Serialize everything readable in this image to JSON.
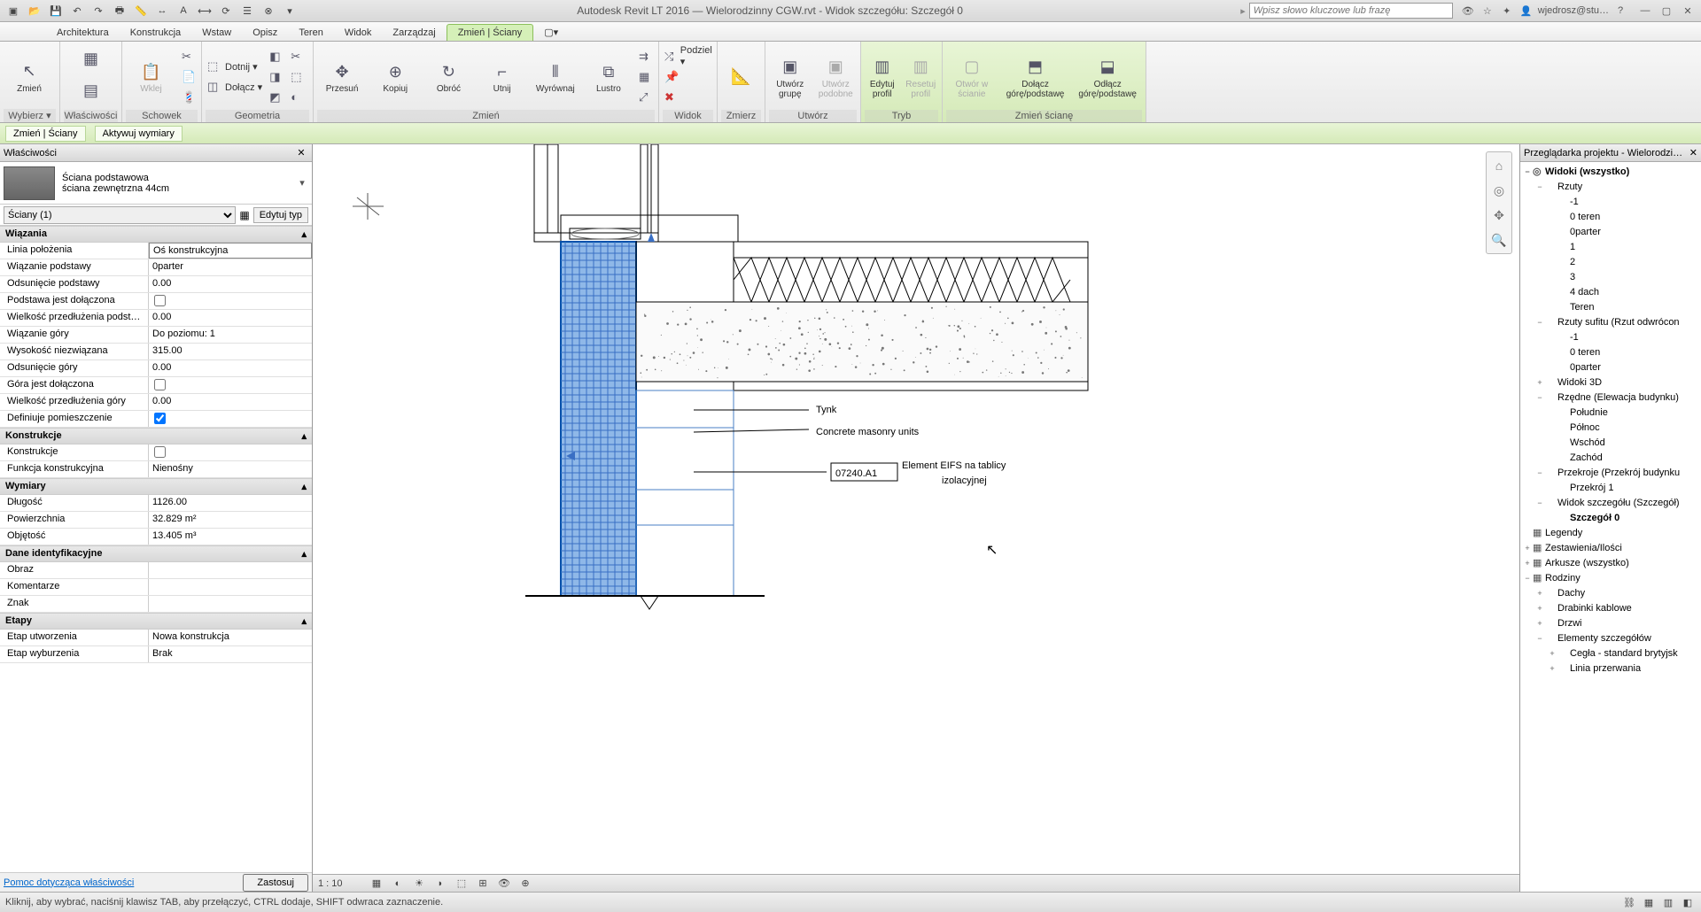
{
  "title": "Autodesk Revit LT 2016 — Wielorodzinny CGW.rvt - Widok szczegółu: Szczegół 0",
  "search_ph": "Wpisz słowo kluczowe lub frazę",
  "user": "wjedrosz@stu…",
  "tabs": [
    "Architektura",
    "Konstrukcja",
    "Wstaw",
    "Opisz",
    "Teren",
    "Widok",
    "Zarządzaj",
    "Zmień | Ściany"
  ],
  "active_tab": 7,
  "ribbon": {
    "wybierz": {
      "lbl": "Wybierz ▾",
      "btn": "Zmień"
    },
    "wlasc": {
      "lbl": "Właściwości"
    },
    "schowek": {
      "lbl": "Schowek",
      "wklej": "Wklej"
    },
    "geo": {
      "lbl": "Geometria",
      "dotnij": "Dotnij ▾",
      "dolacz": "Dołącz ▾"
    },
    "zm": {
      "lbl": "Zmień",
      "przesun": "Przesuń",
      "kopiuj": "Kopiuj",
      "obroc": "Obróć",
      "utnij": "Utnij",
      "wyrownaj": "Wyrównaj",
      "lustro": "Lustro"
    },
    "widok": {
      "lbl": "Widok",
      "podziel": "Podziel ▾"
    },
    "zmierz": {
      "lbl": "Zmierz"
    },
    "utworz": {
      "lbl": "Utwórz",
      "grupe": "Utwórz\ngrupę",
      "podobne": "Utwórz\npodobne"
    },
    "tryb": {
      "lbl": "Tryb",
      "edytuj": "Edytuj\nprofil",
      "resetuj": "Resetuj\nprofil"
    },
    "sciane": {
      "lbl": "Zmień ścianę",
      "otwor": "Otwór\nw ścianie",
      "dolg": "Dołącz\ngórę/podstawę",
      "odlg": "Odłącz\ngórę/podstawę"
    }
  },
  "subrib": [
    "Zmień | Ściany",
    "Aktywuj wymiary"
  ],
  "props": {
    "hdr": "Właściwości",
    "type_name": "Ściana podstawowa",
    "type_sub": "ściana zewnętrzna 44cm",
    "filter": "Ściany (1)",
    "edit_type": "Edytuj typ",
    "groups": [
      {
        "name": "Wiązania",
        "rows": [
          {
            "n": "Linia położenia",
            "v": "Oś konstrukcyjna",
            "sel": true
          },
          {
            "n": "Wiązanie podstawy",
            "v": "0parter"
          },
          {
            "n": "Odsunięcie podstawy",
            "v": "0.00"
          },
          {
            "n": "Podstawa jest dołączona",
            "v": "",
            "chk": false
          },
          {
            "n": "Wielkość przedłużenia podst…",
            "v": "0.00"
          },
          {
            "n": "Wiązanie góry",
            "v": "Do poziomu: 1"
          },
          {
            "n": "Wysokość niezwiązana",
            "v": "315.00"
          },
          {
            "n": "Odsunięcie góry",
            "v": "0.00"
          },
          {
            "n": "Góra jest dołączona",
            "v": "",
            "chk": false
          },
          {
            "n": "Wielkość przedłużenia góry",
            "v": "0.00"
          },
          {
            "n": "Definiuje pomieszczenie",
            "v": "",
            "chk": true
          }
        ]
      },
      {
        "name": "Konstrukcje",
        "rows": [
          {
            "n": "Konstrukcje",
            "v": "",
            "chk": false
          },
          {
            "n": "Funkcja konstrukcyjna",
            "v": "Nienośny"
          }
        ]
      },
      {
        "name": "Wymiary",
        "rows": [
          {
            "n": "Długość",
            "v": "1126.00"
          },
          {
            "n": "Powierzchnia",
            "v": "32.829 m²"
          },
          {
            "n": "Objętość",
            "v": "13.405 m³"
          }
        ]
      },
      {
        "name": "Dane identyfikacyjne",
        "rows": [
          {
            "n": "Obraz",
            "v": ""
          },
          {
            "n": "Komentarze",
            "v": ""
          },
          {
            "n": "Znak",
            "v": ""
          }
        ]
      },
      {
        "name": "Etapy",
        "rows": [
          {
            "n": "Etap utworzenia",
            "v": "Nowa konstrukcja"
          },
          {
            "n": "Etap wyburzenia",
            "v": "Brak"
          }
        ]
      }
    ],
    "help": "Pomoc dotycząca właściwości",
    "apply": "Zastosuj"
  },
  "canvas": {
    "scale": "1 : 10",
    "labels": {
      "tynk": "Tynk",
      "cmu": "Concrete masonry units",
      "eifs_code": "07240.A1",
      "eifs": "Element EIFS na tablicy\nizolacyjnej"
    }
  },
  "browser": {
    "hdr": "Przeglądarka projektu - Wielorodzi…",
    "nodes": [
      {
        "l": 0,
        "tw": "−",
        "ic": "◎",
        "t": "Widoki (wszystko)",
        "b": true
      },
      {
        "l": 1,
        "tw": "−",
        "t": "Rzuty"
      },
      {
        "l": 2,
        "t": "-1"
      },
      {
        "l": 2,
        "t": "0 teren"
      },
      {
        "l": 2,
        "t": "0parter"
      },
      {
        "l": 2,
        "t": "1"
      },
      {
        "l": 2,
        "t": "2"
      },
      {
        "l": 2,
        "t": "3"
      },
      {
        "l": 2,
        "t": "4 dach"
      },
      {
        "l": 2,
        "t": "Teren"
      },
      {
        "l": 1,
        "tw": "−",
        "t": "Rzuty sufitu (Rzut odwrócon"
      },
      {
        "l": 2,
        "t": "-1"
      },
      {
        "l": 2,
        "t": "0 teren"
      },
      {
        "l": 2,
        "t": "0parter"
      },
      {
        "l": 1,
        "tw": "+",
        "t": "Widoki 3D"
      },
      {
        "l": 1,
        "tw": "−",
        "t": "Rzędne (Elewacja budynku)"
      },
      {
        "l": 2,
        "t": "Południe"
      },
      {
        "l": 2,
        "t": "Północ"
      },
      {
        "l": 2,
        "t": "Wschód"
      },
      {
        "l": 2,
        "t": "Zachód"
      },
      {
        "l": 1,
        "tw": "−",
        "t": "Przekroje (Przekrój budynku"
      },
      {
        "l": 2,
        "t": "Przekrój 1"
      },
      {
        "l": 1,
        "tw": "−",
        "t": "Widok szczegółu (Szczegół)"
      },
      {
        "l": 2,
        "t": "Szczegół 0",
        "b": true
      },
      {
        "l": 0,
        "tw": "",
        "ic": "▦",
        "t": "Legendy"
      },
      {
        "l": 0,
        "tw": "+",
        "ic": "▦",
        "t": "Zestawienia/Ilości"
      },
      {
        "l": 0,
        "tw": "+",
        "ic": "▦",
        "t": "Arkusze (wszystko)"
      },
      {
        "l": 0,
        "tw": "−",
        "ic": "▦",
        "t": "Rodziny"
      },
      {
        "l": 1,
        "tw": "+",
        "t": "Dachy"
      },
      {
        "l": 1,
        "tw": "+",
        "t": "Drabinki kablowe"
      },
      {
        "l": 1,
        "tw": "+",
        "t": "Drzwi"
      },
      {
        "l": 1,
        "tw": "−",
        "t": "Elementy szczegółów"
      },
      {
        "l": 2,
        "tw": "+",
        "t": "Cegła - standard brytyjsk"
      },
      {
        "l": 2,
        "tw": "+",
        "t": "Linia przerwania"
      }
    ]
  },
  "status": "Kliknij, aby wybrać, naciśnij klawisz TAB, aby przełączyć, CTRL dodaje, SHIFT odwraca zaznaczenie."
}
